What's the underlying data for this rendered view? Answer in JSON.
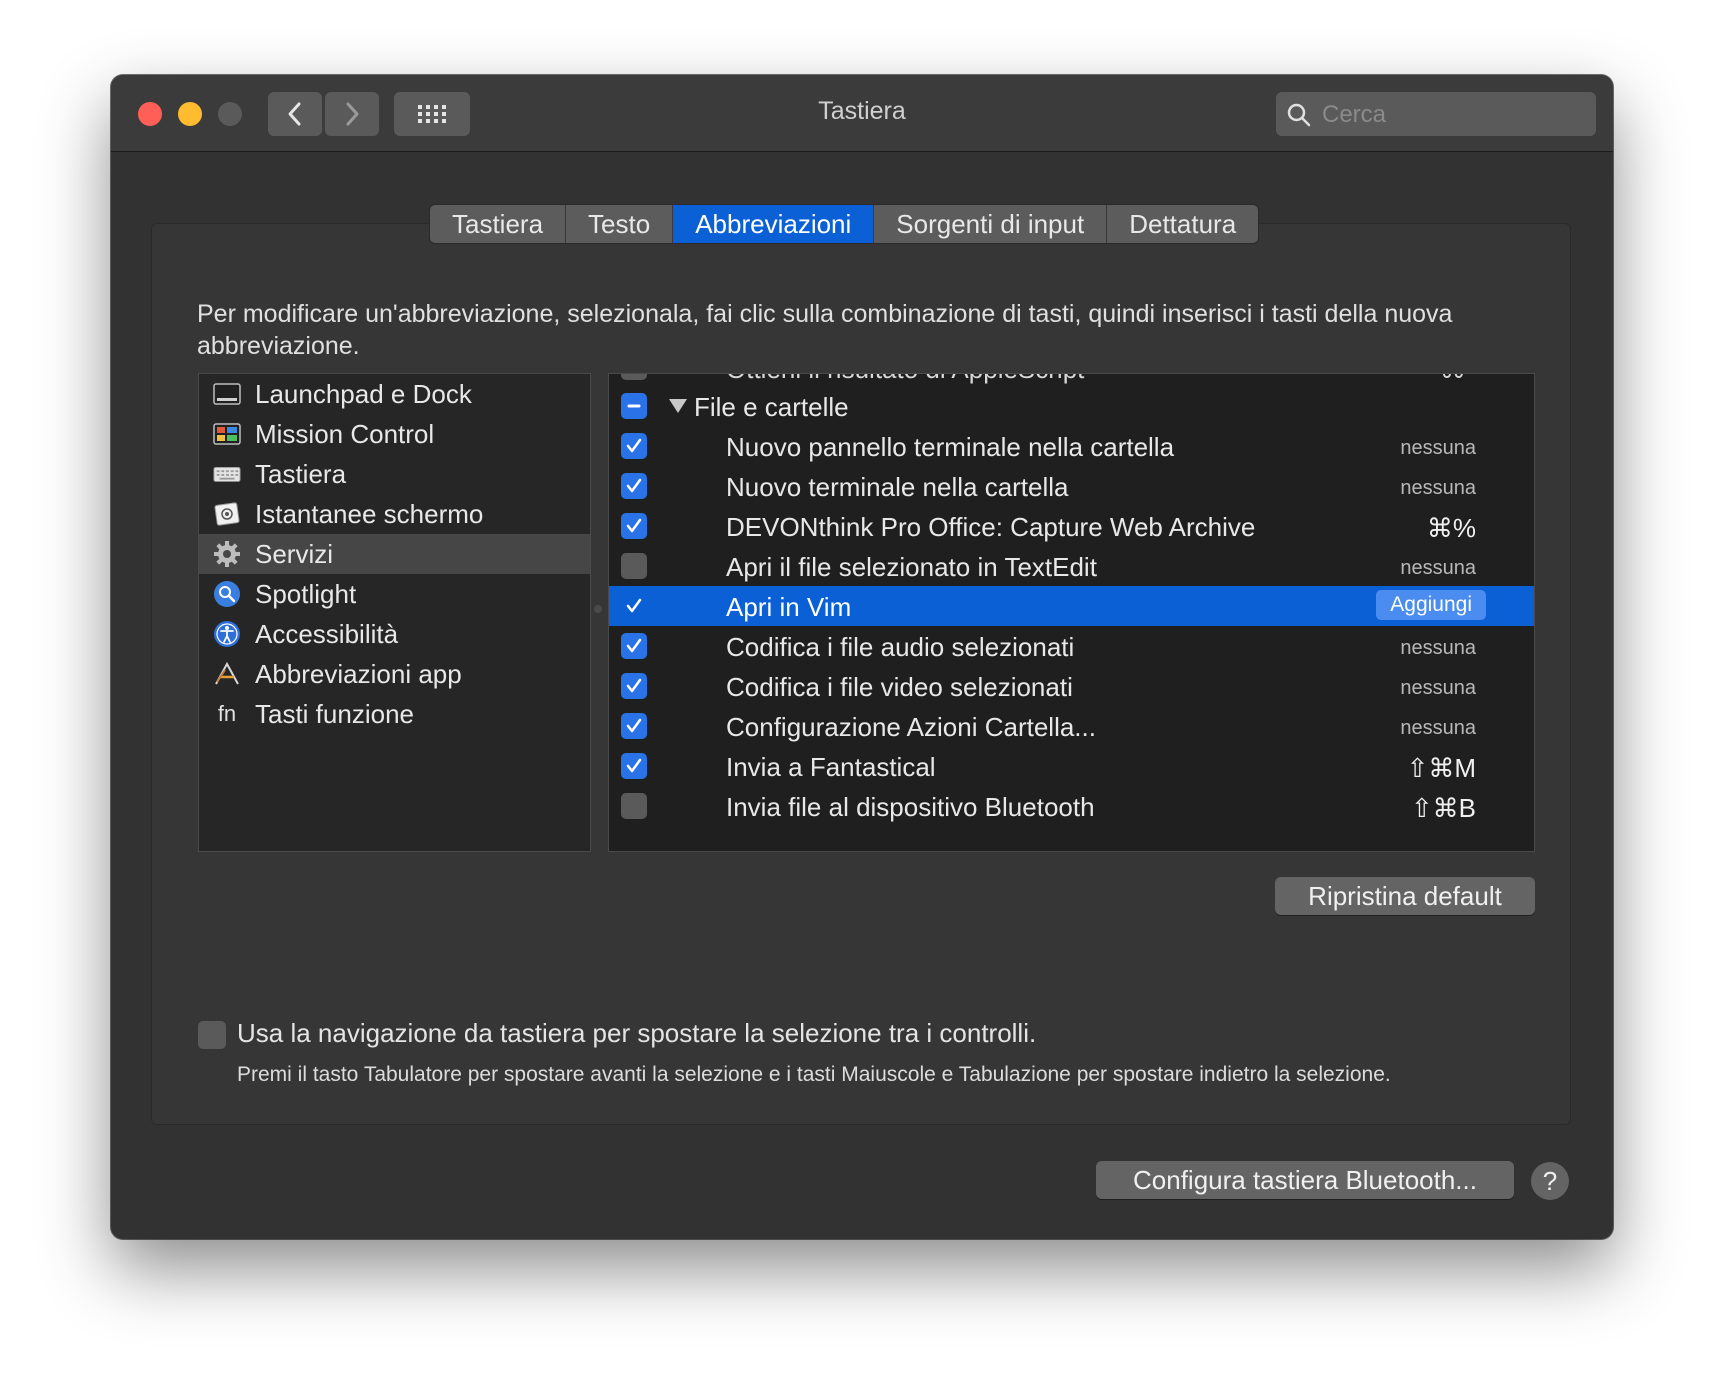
{
  "window": {
    "title": "Tastiera",
    "search_placeholder": "Cerca"
  },
  "tabs": [
    {
      "label": "Tastiera",
      "active": false
    },
    {
      "label": "Testo",
      "active": false
    },
    {
      "label": "Abbreviazioni",
      "active": true
    },
    {
      "label": "Sorgenti di input",
      "active": false
    },
    {
      "label": "Dettatura",
      "active": false
    }
  ],
  "instructions": "Per modificare un'abbreviazione, selezionala, fai clic sulla combinazione di tasti, quindi inserisci i tasti della nuova abbreviazione.",
  "categories": [
    {
      "label": "Launchpad e Dock",
      "icon": "launchpad-dock-icon"
    },
    {
      "label": "Mission Control",
      "icon": "mission-control-icon"
    },
    {
      "label": "Tastiera",
      "icon": "keyboard-icon"
    },
    {
      "label": "Istantanee schermo",
      "icon": "screenshot-icon"
    },
    {
      "label": "Servizi",
      "icon": "gear-icon",
      "selected": true
    },
    {
      "label": "Spotlight",
      "icon": "spotlight-icon"
    },
    {
      "label": "Accessibilità",
      "icon": "accessibility-icon"
    },
    {
      "label": "Abbreviazioni app",
      "icon": "app-shortcuts-icon"
    },
    {
      "label": "Tasti funzione",
      "icon": "fn-key-icon"
    }
  ],
  "services": {
    "cut_off_row": {
      "label": "Ottieni il risultato di AppleScript",
      "shortcut": "⌘*"
    },
    "group": {
      "label": "File e cartelle",
      "state": "mixed"
    },
    "items": [
      {
        "label": "Nuovo pannello terminale nella cartella",
        "checked": true,
        "shortcut": "nessuna"
      },
      {
        "label": "Nuovo terminale nella cartella",
        "checked": true,
        "shortcut": "nessuna"
      },
      {
        "label": "DEVONthink Pro Office: Capture Web Archive",
        "checked": true,
        "shortcut": "⌘%"
      },
      {
        "label": "Apri il file selezionato in TextEdit",
        "checked": false,
        "shortcut": "nessuna"
      },
      {
        "label": "Apri in Vim",
        "checked": true,
        "selected": true,
        "button": "Aggiungi"
      },
      {
        "label": "Codifica i file audio selezionati",
        "checked": true,
        "shortcut": "nessuna"
      },
      {
        "label": "Codifica i file video selezionati",
        "checked": true,
        "shortcut": "nessuna"
      },
      {
        "label": "Configurazione Azioni Cartella...",
        "checked": true,
        "shortcut": "nessuna"
      },
      {
        "label": "Invia a Fantastical",
        "checked": true,
        "shortcut": "⇧⌘M"
      },
      {
        "label": "Invia file al dispositivo Bluetooth",
        "checked": false,
        "shortcut": "⇧⌘B"
      }
    ]
  },
  "restore_button": "Ripristina default",
  "keyboard_navigation": {
    "checked": false,
    "label": "Usa la navigazione da tastiera per spostare la selezione tra i controlli.",
    "hint": "Premi il tasto Tabulatore per spostare avanti la selezione e i tasti Maiuscole e Tabulazione per spostare indietro la selezione."
  },
  "bluetooth_button": "Configura tastiera Bluetooth...",
  "help_button": "?",
  "colors": {
    "accent": "#0b60d6",
    "close": "#ff5f57",
    "minimize": "#febc2e",
    "window_bg": "#323232"
  }
}
